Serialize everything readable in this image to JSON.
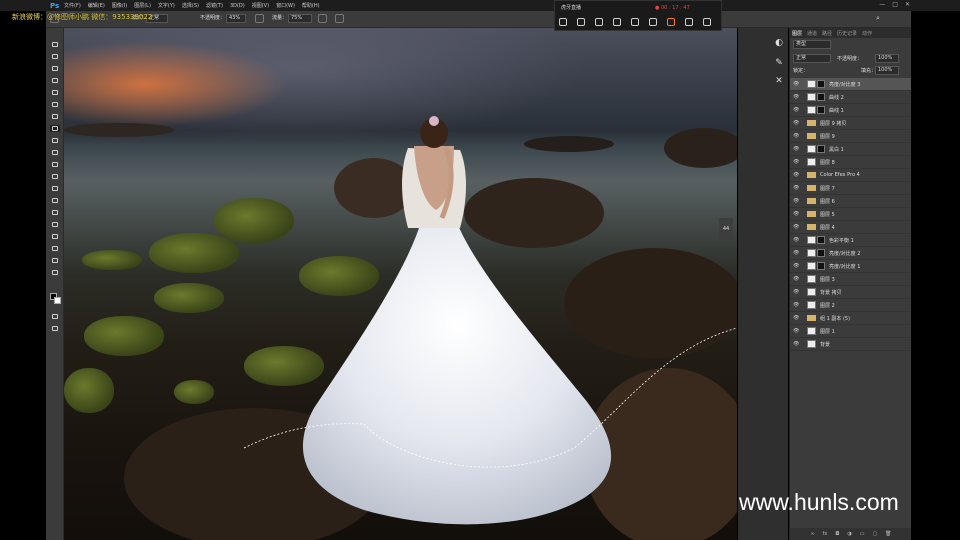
{
  "app": {
    "logo": "Ps"
  },
  "menu": [
    "文件(F)",
    "编辑(E)",
    "图像(I)",
    "图层(L)",
    "文字(Y)",
    "选择(S)",
    "滤镜(T)",
    "3D(D)",
    "视图(V)",
    "窗口(W)",
    "帮助(H)"
  ],
  "window_controls": [
    "—",
    "□",
    "✕"
  ],
  "watermark": {
    "text": "新浪微博：@修图师小鹏 微信：935339022"
  },
  "options_bar": {
    "mode_label": "模式：",
    "mode_value": "正常",
    "opacity_label": "不透明度：",
    "opacity_value": "43%",
    "flow_label": "流量：",
    "flow_value": "75%"
  },
  "streamer_panel": {
    "label": "虎牙直播",
    "timer": "● 00 : 17 : 47"
  },
  "navigator_label": "44",
  "layers_panel": {
    "tabs": [
      "图层",
      "通道",
      "路径",
      "历史记录",
      "动作"
    ],
    "filter_kind": "类型",
    "blend_mode": "正常",
    "opacity_label": "不透明度：",
    "opacity_value": "100%",
    "lock_label": "锁定：",
    "fill_label": "填充：",
    "fill_value": "100%",
    "layers": [
      {
        "name": "亮度/对比度 3",
        "kind": "adjust",
        "selected": true
      },
      {
        "name": "曲线 2",
        "kind": "adjust"
      },
      {
        "name": "曲线 1",
        "kind": "adjust"
      },
      {
        "name": "图层 9 拷贝",
        "kind": "folder"
      },
      {
        "name": "图层 9",
        "kind": "folder"
      },
      {
        "name": "黑白 1",
        "kind": "adjust"
      },
      {
        "name": "图层 8",
        "kind": "pixel"
      },
      {
        "name": "Color Efex Pro 4",
        "kind": "folder"
      },
      {
        "name": "图层 7",
        "kind": "folder"
      },
      {
        "name": "图层 6",
        "kind": "folder"
      },
      {
        "name": "图层 5",
        "kind": "folder"
      },
      {
        "name": "图层 4",
        "kind": "folder"
      },
      {
        "name": "色彩平衡 1",
        "kind": "adjust"
      },
      {
        "name": "亮度/对比度 2",
        "kind": "adjust"
      },
      {
        "name": "亮度/对比度 1",
        "kind": "adjust"
      },
      {
        "name": "图层 3",
        "kind": "pixel"
      },
      {
        "name": "背景 拷贝",
        "kind": "pixel"
      },
      {
        "name": "图层 2",
        "kind": "pixel"
      },
      {
        "name": "组 1 副本 (5)",
        "kind": "folder"
      },
      {
        "name": "图层 1",
        "kind": "pixel"
      },
      {
        "name": "背景",
        "kind": "pixel"
      }
    ]
  },
  "footer": {
    "site_url": "www.hunls.com"
  },
  "colors": {
    "app_bg": "#3b3b3b",
    "menubar": "#1d1d1d",
    "accent": "#31a8ff",
    "watermark": "#e8d24a",
    "record": "#ff7a1a"
  }
}
